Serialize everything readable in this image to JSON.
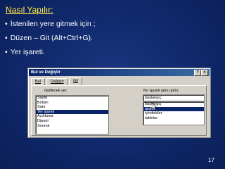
{
  "slide": {
    "title": "Nasıl  Yapılır:",
    "bullets": [
      "İstenilen yere gitmek için ;",
      "Düzen – Git (Alt+Ctrl+G).",
      "Yer işareti."
    ],
    "page_number": "17"
  },
  "dialog": {
    "title": "Bul ve Değiştir",
    "title_buttons": [
      "?",
      "×"
    ],
    "tabs": [
      "Bul",
      "Değiştir",
      "Git"
    ],
    "active_tab": 2,
    "goto_label": "Gidilecek yer:",
    "goto_items": [
      "Sayfa",
      "Bölüm",
      "Satır",
      "Yer işareti",
      "Açıklama",
      "Dipnot",
      "Sonnot"
    ],
    "goto_selected": 3,
    "bookmark_label": "Yer işareti adını girin:",
    "bookmark_value": "başlangıç",
    "bookmark_items": [
      "başlangıç",
      "grafik",
      "içindekiler",
      "tablolar"
    ],
    "bookmark_selected": 1
  },
  "colors": {
    "title": "#ffe84a",
    "text": "#ffffff",
    "selection": "#0a246a"
  }
}
